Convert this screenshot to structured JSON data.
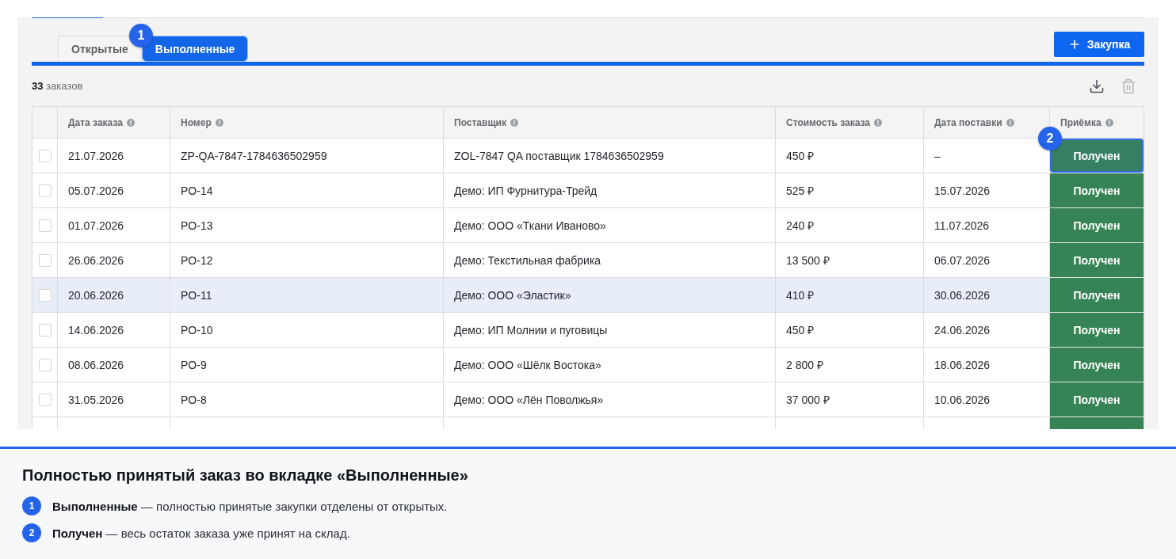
{
  "tabs": [
    {
      "label": "Открытые",
      "selected": false
    },
    {
      "label": "Выполненные",
      "selected": true,
      "callout": "1"
    }
  ],
  "create_button": {
    "label": "Закупка"
  },
  "summary": {
    "count": "33",
    "label": "заказов"
  },
  "actions": [
    {
      "kind": "download",
      "disabled": false
    },
    {
      "kind": "delete",
      "disabled": true
    }
  ],
  "table": {
    "columns": [
      "Дата заказа",
      "Номер",
      "Поставщик",
      "Стоимость заказа",
      "Дата поставки",
      "Приёмка"
    ],
    "rows": [
      {
        "checked": false,
        "highlighted": false,
        "order_date": "21.07.2026",
        "number": "ZP-QA-7847-1784636502959",
        "supplier": "ZOL-7847 QA поставщик 1784636502959",
        "cost": "450 ₽",
        "delivery_date": "–",
        "status": {
          "kind": "received",
          "label": "Получен",
          "focused": true,
          "callout": "2"
        }
      },
      {
        "checked": false,
        "highlighted": false,
        "order_date": "05.07.2026",
        "number": "PO-14",
        "supplier": "Демо: ИП Фурнитура-Трейд",
        "cost": "525 ₽",
        "delivery_date": "15.07.2026",
        "status": {
          "kind": "received",
          "label": "Получен",
          "focused": false
        }
      },
      {
        "checked": false,
        "highlighted": false,
        "order_date": "01.07.2026",
        "number": "PO-13",
        "supplier": "Демо: ООО «Ткани Иваново»",
        "cost": "240 ₽",
        "delivery_date": "11.07.2026",
        "status": {
          "kind": "received",
          "label": "Получен",
          "focused": false
        }
      },
      {
        "checked": false,
        "highlighted": false,
        "order_date": "26.06.2026",
        "number": "PO-12",
        "supplier": "Демо: Текстильная фабрика",
        "cost": "13 500 ₽",
        "delivery_date": "06.07.2026",
        "status": {
          "kind": "received",
          "label": "Получен",
          "focused": false
        }
      },
      {
        "checked": false,
        "highlighted": true,
        "order_date": "20.06.2026",
        "number": "PO-11",
        "supplier": "Демо: ООО «Эластик»",
        "cost": "410 ₽",
        "delivery_date": "30.06.2026",
        "status": {
          "kind": "received",
          "label": "Получен",
          "focused": false
        }
      },
      {
        "checked": false,
        "highlighted": false,
        "order_date": "14.06.2026",
        "number": "PO-10",
        "supplier": "Демо: ИП Молнии и пуговицы",
        "cost": "450 ₽",
        "delivery_date": "24.06.2026",
        "status": {
          "kind": "received",
          "label": "Получен",
          "focused": false
        }
      },
      {
        "checked": false,
        "highlighted": false,
        "order_date": "08.06.2026",
        "number": "PO-9",
        "supplier": "Демо: ООО «Шёлк Востока»",
        "cost": "2 800 ₽",
        "delivery_date": "18.06.2026",
        "status": {
          "kind": "received",
          "label": "Получен",
          "focused": false
        }
      },
      {
        "checked": false,
        "highlighted": false,
        "order_date": "31.05.2026",
        "number": "PO-8",
        "supplier": "Демо: ООО «Лён Поволжья»",
        "cost": "37 000 ₽",
        "delivery_date": "10.06.2026",
        "status": {
          "kind": "received",
          "label": "Получен",
          "focused": false
        }
      },
      {
        "highlighted": false,
        "status": {
          "kind": "received",
          "focused": false
        }
      }
    ]
  },
  "legend": {
    "title": "Полностью принятый заказ во вкладке «Выполненные»",
    "items": [
      {
        "marker": "1",
        "text": "**Выполненные** — полностью принятые закупки отделены от открытых."
      },
      {
        "marker": "2",
        "text": "**Получен** — весь остаток заказа уже принят на склад."
      }
    ]
  }
}
